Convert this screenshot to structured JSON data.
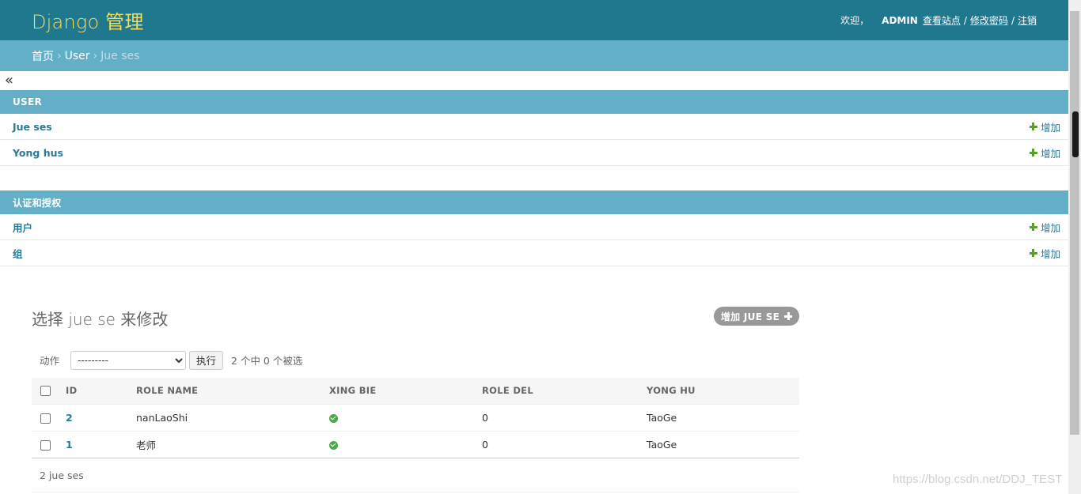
{
  "header": {
    "brand": "Django 管理",
    "welcome": "欢迎，",
    "username": "ADMIN",
    "view_site": "查看站点",
    "change_password": "修改密码",
    "logout": "注销",
    "sep": "/"
  },
  "breadcrumbs": {
    "home": "首页",
    "app": "User",
    "current": "Jue ses",
    "sep": "›"
  },
  "nav_toggle": "«",
  "modules": [
    {
      "caption": "USER",
      "models": [
        {
          "name": "Jue ses",
          "add": "增加"
        },
        {
          "name": "Yong hus",
          "add": "增加"
        }
      ]
    },
    {
      "caption": "认证和授权",
      "models": [
        {
          "name": "用户",
          "add": "增加"
        },
        {
          "name": "组",
          "add": "增加"
        }
      ]
    }
  ],
  "changelist": {
    "title": "选择 jue se 来修改",
    "add_button": "增加 JUE SE",
    "action_label": "动作",
    "action_select": "---------",
    "go_button": "执行",
    "selection_count": "2 个中 0 个被选",
    "columns": [
      "ID",
      "ROLE NAME",
      "XING BIE",
      "ROLE DEL",
      "YONG HU"
    ],
    "rows": [
      {
        "id": "2",
        "role_name": "nanLaoShi",
        "xing_bie": "yes-icon",
        "role_del": "0",
        "yong_hu": "TaoGe"
      },
      {
        "id": "1",
        "role_name": "老师",
        "xing_bie": "yes-icon",
        "role_del": "0",
        "yong_hu": "TaoGe"
      }
    ],
    "paginator": "2 jue ses"
  },
  "watermark": "https://blog.csdn.net/DDJ_TEST",
  "colors": {
    "header_bg": "#20788f",
    "brand": "#f5dd5d",
    "breadcrumb_bg": "#63afc7",
    "link": "#2a7a9a",
    "add_green": "#5a9e2f"
  }
}
